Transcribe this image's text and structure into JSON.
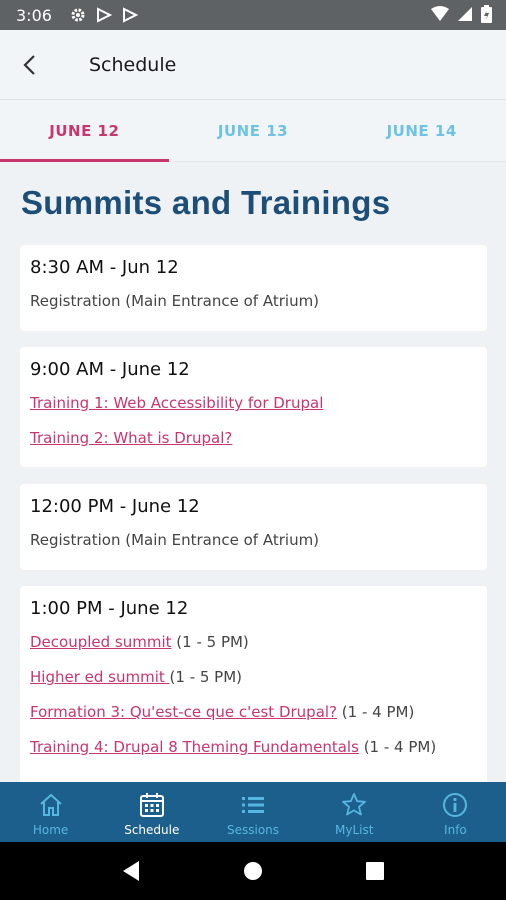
{
  "status": {
    "time": "3:06"
  },
  "header": {
    "title": "Schedule"
  },
  "tabs": [
    {
      "label": "JUNE 12",
      "active": true
    },
    {
      "label": "JUNE 13",
      "active": false
    },
    {
      "label": "JUNE 14",
      "active": false
    }
  ],
  "page": {
    "title": "Summits and Trainings"
  },
  "cards": [
    {
      "time": "8:30 AM - Jun 12",
      "items": [
        {
          "text": "Registration (Main Entrance of Atrium)"
        }
      ]
    },
    {
      "time": "9:00 AM - June 12",
      "items": [
        {
          "link": "Training 1: Web Accessibility for Drupal"
        },
        {
          "link": "Training 2: What is Drupal?"
        }
      ]
    },
    {
      "time": "12:00 PM - June 12",
      "items": [
        {
          "text": "Registration (Main Entrance of Atrium)"
        }
      ]
    },
    {
      "time": "1:00 PM - June 12",
      "items": [
        {
          "link": "Decoupled summit",
          "suffix": " (1 - 5 PM)"
        },
        {
          "link": "Higher ed summit ",
          "suffix": "(1 - 5 PM)"
        },
        {
          "link": "Formation 3: Qu'est-ce que c'est Drupal?",
          "suffix": " (1 - 4 PM)"
        },
        {
          "link": "Training 4: Drupal 8 Theming Fundamentals",
          "suffix": " (1 - 4 PM)"
        }
      ]
    }
  ],
  "bottom_nav": [
    {
      "label": "Home",
      "icon": "home-icon",
      "active": false
    },
    {
      "label": "Schedule",
      "icon": "calendar-icon",
      "active": true
    },
    {
      "label": "Sessions",
      "icon": "list-icon",
      "active": false
    },
    {
      "label": "MyList",
      "icon": "star-icon",
      "active": false
    },
    {
      "label": "Info",
      "icon": "info-icon",
      "active": false
    }
  ],
  "colors": {
    "accent": "#c7366f",
    "tab_inactive": "#6ec3e4",
    "title": "#1c4e77",
    "nav_bg": "#1d5f8c"
  }
}
